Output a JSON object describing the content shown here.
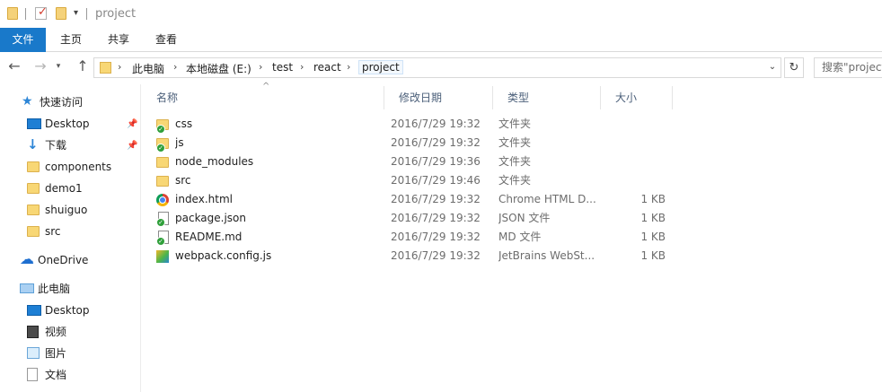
{
  "window": {
    "title": "project"
  },
  "ribbon": {
    "tabs": [
      {
        "label": "文件",
        "active": true
      },
      {
        "label": "主页",
        "active": false
      },
      {
        "label": "共享",
        "active": false
      },
      {
        "label": "查看",
        "active": false
      }
    ]
  },
  "address": {
    "crumbs": [
      "此电脑",
      "本地磁盘 (E:)",
      "test",
      "react",
      "project"
    ],
    "search_placeholder": "搜索\"project\""
  },
  "nav": {
    "quick_access": "快速访问",
    "quick_items": [
      "Desktop",
      "下载",
      "components",
      "demo1",
      "shuiguo",
      "src"
    ],
    "onedrive": "OneDrive",
    "this_pc": "此电脑",
    "pc_items": [
      "Desktop",
      "视频",
      "图片",
      "文档"
    ]
  },
  "columns": {
    "name": "名称",
    "date": "修改日期",
    "type": "类型",
    "size": "大小"
  },
  "files": [
    {
      "name": "css",
      "date": "2016/7/29 19:32",
      "type": "文件夹",
      "size": "",
      "icon": "folder-synced-icon"
    },
    {
      "name": "js",
      "date": "2016/7/29 19:32",
      "type": "文件夹",
      "size": "",
      "icon": "folder-synced-icon"
    },
    {
      "name": "node_modules",
      "date": "2016/7/29 19:36",
      "type": "文件夹",
      "size": "",
      "icon": "folder-icon"
    },
    {
      "name": "src",
      "date": "2016/7/29 19:46",
      "type": "文件夹",
      "size": "",
      "icon": "folder-icon"
    },
    {
      "name": "index.html",
      "date": "2016/7/29 19:32",
      "type": "Chrome HTML D...",
      "size": "1 KB",
      "icon": "chrome-html-icon"
    },
    {
      "name": "package.json",
      "date": "2016/7/29 19:32",
      "type": "JSON 文件",
      "size": "1 KB",
      "icon": "json-file-icon"
    },
    {
      "name": "README.md",
      "date": "2016/7/29 19:32",
      "type": "MD 文件",
      "size": "1 KB",
      "icon": "md-file-icon"
    },
    {
      "name": "webpack.config.js",
      "date": "2016/7/29 19:32",
      "type": "JetBrains WebSt...",
      "size": "1 KB",
      "icon": "webstorm-js-icon"
    }
  ]
}
